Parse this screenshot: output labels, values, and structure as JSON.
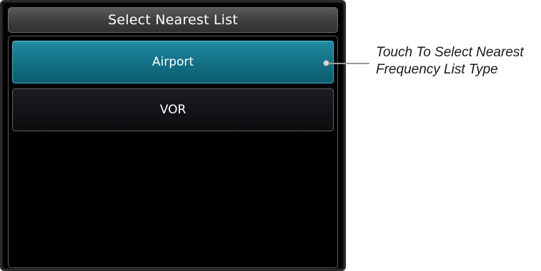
{
  "dialog": {
    "title": "Select Nearest List",
    "options": [
      {
        "label": "Airport",
        "selected": true
      },
      {
        "label": "VOR",
        "selected": false
      }
    ]
  },
  "annotation": {
    "line1": "Touch To Select Nearest",
    "line2": "Frequency List Type"
  },
  "colors": {
    "selected_button": "#136f84",
    "background": "#000000"
  }
}
